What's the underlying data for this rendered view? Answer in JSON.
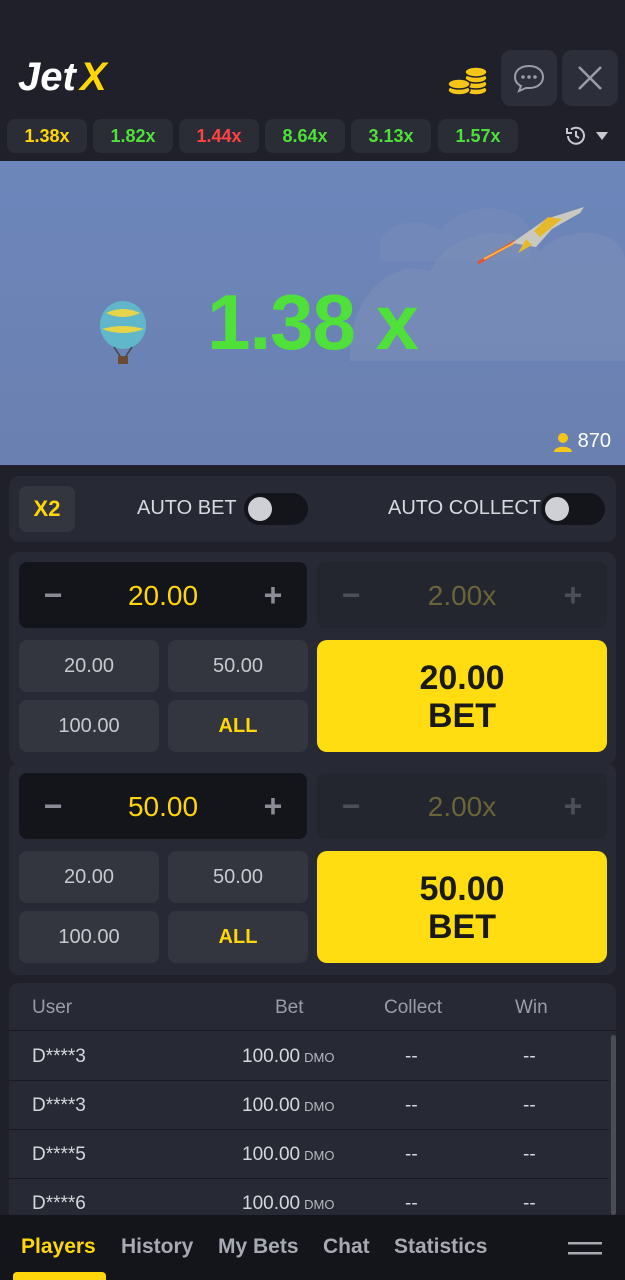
{
  "header": {
    "logo": "JetX"
  },
  "history": {
    "items": [
      {
        "value": "1.38x",
        "color": "#ffd60a"
      },
      {
        "value": "1.82x",
        "color": "#4fe03a"
      },
      {
        "value": "1.44x",
        "color": "#ff4343"
      },
      {
        "value": "8.64x",
        "color": "#4fe03a"
      },
      {
        "value": "3.13x",
        "color": "#4fe03a"
      },
      {
        "value": "1.57x",
        "color": "#4fe03a"
      }
    ]
  },
  "game": {
    "multiplier": "1.38 x",
    "players_online": "870"
  },
  "auto": {
    "x2_label": "X2",
    "auto_bet_label": "AUTO BET",
    "auto_collect_label": "AUTO COLLECT"
  },
  "bets": [
    {
      "amount": "20.00",
      "collect": "2.00x",
      "quick": [
        "20.00",
        "50.00",
        "100.00",
        "ALL"
      ],
      "button_amount": "20.00",
      "button_label": "BET"
    },
    {
      "amount": "50.00",
      "collect": "2.00x",
      "quick": [
        "20.00",
        "50.00",
        "100.00",
        "ALL"
      ],
      "button_amount": "50.00",
      "button_label": "BET"
    }
  ],
  "table": {
    "headers": [
      "User",
      "Bet",
      "Collect",
      "Win"
    ],
    "rows": [
      {
        "user": "D****3",
        "bet": "100.00",
        "currency": "DMO",
        "collect": "--",
        "win": "--"
      },
      {
        "user": "D****3",
        "bet": "100.00",
        "currency": "DMO",
        "collect": "--",
        "win": "--"
      },
      {
        "user": "D****5",
        "bet": "100.00",
        "currency": "DMO",
        "collect": "--",
        "win": "--"
      },
      {
        "user": "D****6",
        "bet": "100.00",
        "currency": "DMO",
        "collect": "--",
        "win": "--"
      }
    ]
  },
  "nav": {
    "tabs": [
      "Players",
      "History",
      "My Bets",
      "Chat",
      "Statistics"
    ],
    "active": "Players"
  },
  "colors": {
    "accent": "#ffd60a",
    "win_green": "#4fe03a",
    "loss_red": "#ff4343"
  }
}
